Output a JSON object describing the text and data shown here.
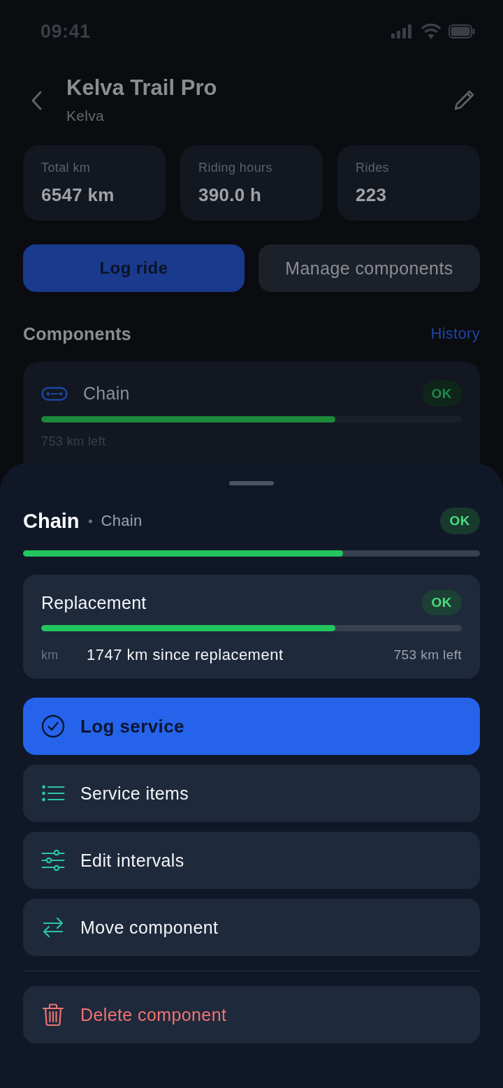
{
  "status_bar": {
    "time": "09:41"
  },
  "header": {
    "title": "Kelva Trail Pro",
    "subtitle": "Kelva"
  },
  "stats": [
    {
      "label": "Total km",
      "value": "6547 km"
    },
    {
      "label": "Riding hours",
      "value": "390.0 h"
    },
    {
      "label": "Rides",
      "value": "223"
    }
  ],
  "actions": [
    {
      "label": "Log ride",
      "kind": "primary"
    },
    {
      "label": "Manage components",
      "kind": "secondary"
    }
  ],
  "components_section": {
    "title": "Components",
    "link": "History",
    "items": [
      {
        "name": "Chain",
        "status": "OK",
        "level": 0.7,
        "remaining": "753 km left"
      }
    ]
  },
  "sheet": {
    "title": "Chain",
    "category": "Chain",
    "status": "OK",
    "level": 0.7,
    "intervals": [
      {
        "name": "Replacement",
        "status": "OK",
        "level": 0.7,
        "unit": "km",
        "since": "1747 km since replacement",
        "remaining": "753 km left"
      }
    ],
    "actions": [
      {
        "label": "Log service",
        "kind": "primary"
      },
      {
        "label": "Service items",
        "kind": "default"
      },
      {
        "label": "Edit intervals",
        "kind": "default"
      },
      {
        "label": "Move component",
        "kind": "default"
      },
      {
        "label": "Delete component",
        "kind": "destructive"
      }
    ]
  }
}
